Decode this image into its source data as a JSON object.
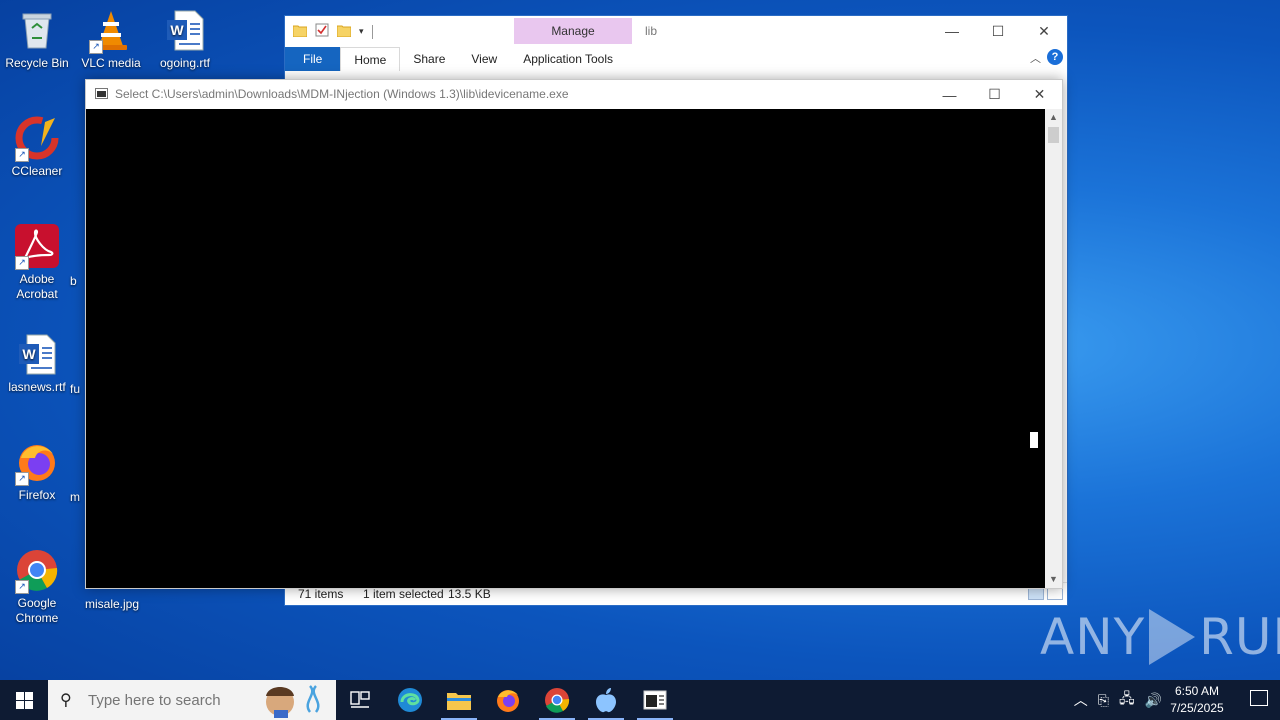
{
  "desktop": {
    "icons": [
      {
        "label": "Recycle Bin"
      },
      {
        "label": "VLC media"
      },
      {
        "label": "ogoing.rtf"
      },
      {
        "label": "CCleaner"
      },
      {
        "label": "Adobe Acrobat"
      },
      {
        "label": "lasnews.rtf"
      },
      {
        "label": "Firefox"
      },
      {
        "label": "Google Chrome"
      },
      {
        "label": "misale.jpg"
      }
    ],
    "partial_labels": [
      "b",
      "fu",
      "m"
    ]
  },
  "explorer": {
    "title": "lib",
    "contextual_tab": "Manage",
    "tabs": [
      "File",
      "Home",
      "Share",
      "View",
      "Application Tools"
    ],
    "status": {
      "item_count": "71 items",
      "selected": "1 item selected",
      "size": "13.5 KB"
    }
  },
  "console": {
    "title": "Select C:\\Users\\admin\\Downloads\\MDM-INjection (Windows 1.3)\\lib\\idevicename.exe"
  },
  "watermark": {
    "left": "ANY",
    "right": "RUN"
  },
  "taskbar": {
    "search_placeholder": "Type here to search",
    "clock_time": "6:50 AM",
    "clock_date": "7/25/2025"
  },
  "colors": {
    "desktop_accent": "#1b73d8",
    "file_tab": "#1565c0",
    "manage_tab": "#e9c7ef",
    "taskbar": "#0e1b33",
    "console_bg": "#000000"
  }
}
